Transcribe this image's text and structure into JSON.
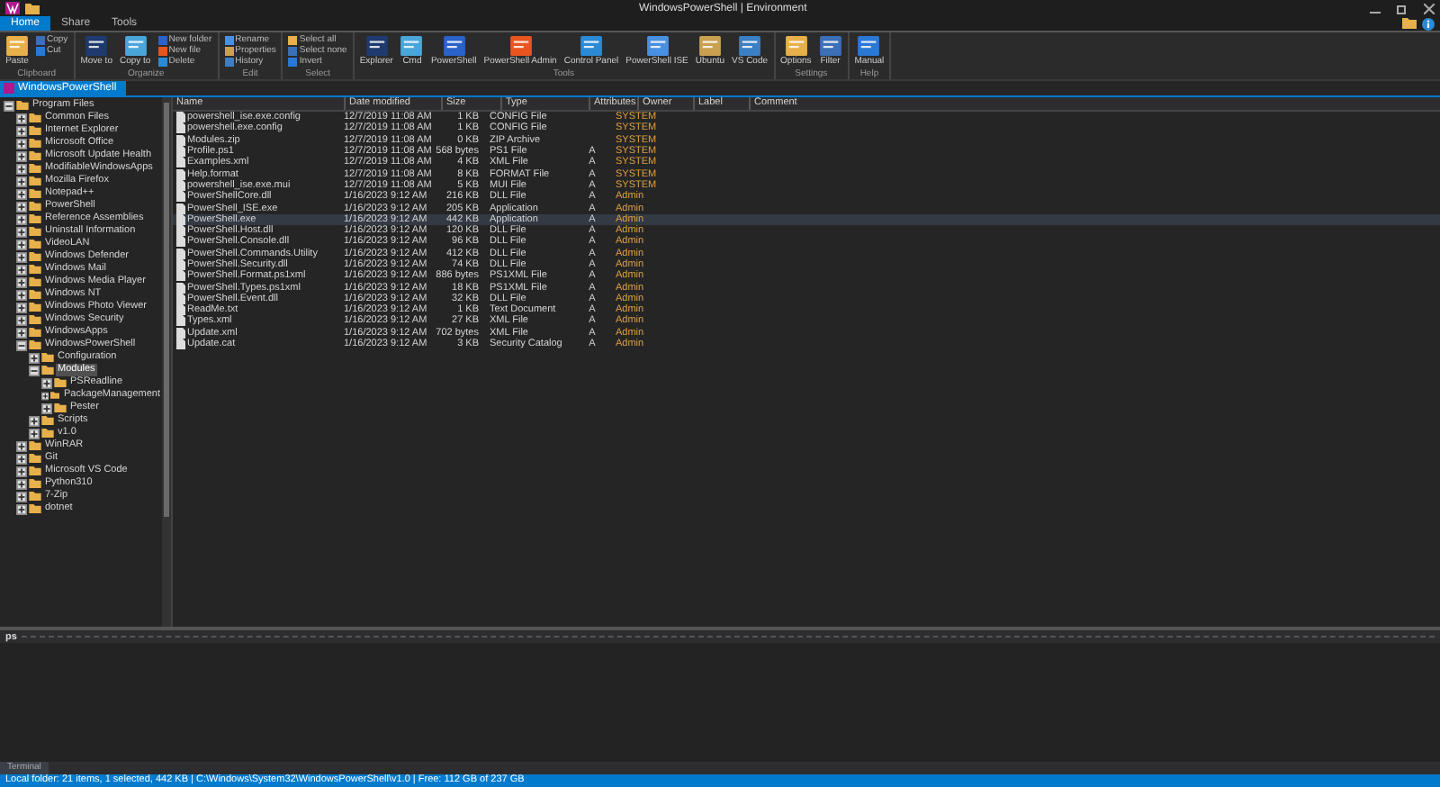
{
  "window": {
    "title": "WindowsPowerShell | Environment"
  },
  "ribbon_tabs": [
    {
      "label": "Home",
      "selected": true
    },
    {
      "label": "Share",
      "selected": false
    },
    {
      "label": "Tools",
      "selected": false
    }
  ],
  "ribbon_groups": [
    {
      "label": "Clipboard",
      "items": [
        {
          "label": "Paste",
          "kind": "large"
        },
        {
          "label": "Copy",
          "kind": "small"
        },
        {
          "label": "Cut",
          "kind": "small"
        }
      ]
    },
    {
      "label": "Organize",
      "items": [
        {
          "label": "Move to",
          "kind": "large"
        },
        {
          "label": "Copy to",
          "kind": "large"
        },
        {
          "label": "New folder",
          "kind": "small"
        },
        {
          "label": "New file",
          "kind": "small"
        },
        {
          "label": "Delete",
          "kind": "small"
        }
      ]
    },
    {
      "label": "Edit",
      "items": [
        {
          "label": "Rename",
          "kind": "small"
        },
        {
          "label": "Properties",
          "kind": "small"
        },
        {
          "label": "History",
          "kind": "small"
        }
      ]
    },
    {
      "label": "Select",
      "items": [
        {
          "label": "Select all",
          "kind": "small"
        },
        {
          "label": "Select none",
          "kind": "small"
        },
        {
          "label": "Invert",
          "kind": "small"
        }
      ]
    },
    {
      "label": "Tools",
      "items": [
        {
          "label": "Explorer",
          "kind": "large"
        },
        {
          "label": "Cmd",
          "kind": "large"
        },
        {
          "label": "PowerShell",
          "kind": "large"
        },
        {
          "label": "PowerShell Admin",
          "kind": "large"
        },
        {
          "label": "Control Panel",
          "kind": "large"
        },
        {
          "label": "PowerShell ISE",
          "kind": "large"
        },
        {
          "label": "Ubuntu",
          "kind": "large"
        },
        {
          "label": "VS Code",
          "kind": "large"
        }
      ]
    },
    {
      "label": "Settings",
      "items": [
        {
          "label": "Options",
          "kind": "large"
        },
        {
          "label": "Filter",
          "kind": "large"
        }
      ]
    },
    {
      "label": "Help",
      "items": [
        {
          "label": "Manual",
          "kind": "large"
        }
      ]
    }
  ],
  "folder_tab": {
    "label": "WindowsPowerShell"
  },
  "tree": [
    {
      "label": "Program Files",
      "expanded": true,
      "selected": false,
      "children": [
        {
          "label": "Common Files",
          "expanded": false,
          "selected": false
        },
        {
          "label": "Internet Explorer",
          "expanded": false,
          "selected": false
        },
        {
          "label": "Microsoft Office",
          "expanded": false,
          "selected": false
        },
        {
          "label": "Microsoft Update Health",
          "expanded": false,
          "selected": false
        },
        {
          "label": "ModifiableWindowsApps",
          "expanded": false,
          "selected": false
        },
        {
          "label": "Mozilla Firefox",
          "expanded": false,
          "selected": false
        },
        {
          "label": "Notepad++",
          "expanded": false,
          "selected": false
        },
        {
          "label": "PowerShell",
          "expanded": false,
          "selected": false
        },
        {
          "label": "Reference Assemblies",
          "expanded": false,
          "selected": false
        },
        {
          "label": "Uninstall Information",
          "expanded": false,
          "selected": false
        },
        {
          "label": "VideoLAN",
          "expanded": false,
          "selected": false
        },
        {
          "label": "Windows Defender",
          "expanded": false,
          "selected": false
        },
        {
          "label": "Windows Mail",
          "expanded": false,
          "selected": false
        },
        {
          "label": "Windows Media Player",
          "expanded": false,
          "selected": false
        },
        {
          "label": "Windows NT",
          "expanded": false,
          "selected": false
        },
        {
          "label": "Windows Photo Viewer",
          "expanded": false,
          "selected": false
        },
        {
          "label": "Windows Security",
          "expanded": false,
          "selected": false
        },
        {
          "label": "WindowsApps",
          "expanded": false,
          "selected": false
        },
        {
          "label": "WindowsPowerShell",
          "expanded": true,
          "selected": false,
          "children": [
            {
              "label": "Configuration",
              "expanded": false,
              "selected": false
            },
            {
              "label": "Modules",
              "expanded": true,
              "selected": true,
              "children": [
                {
                  "label": "PSReadline",
                  "expanded": false,
                  "selected": false
                },
                {
                  "label": "PackageManagement",
                  "expanded": false,
                  "selected": false
                },
                {
                  "label": "Pester",
                  "expanded": false,
                  "selected": false
                }
              ]
            },
            {
              "label": "Scripts",
              "expanded": false,
              "selected": false
            },
            {
              "label": "v1.0",
              "expanded": false,
              "selected": false
            }
          ]
        },
        {
          "label": "WinRAR",
          "expanded": false,
          "selected": false
        },
        {
          "label": "Git",
          "expanded": false,
          "selected": false
        },
        {
          "label": "Microsoft VS Code",
          "expanded": false,
          "selected": false
        },
        {
          "label": "Python310",
          "expanded": false,
          "selected": false
        },
        {
          "label": "7-Zip",
          "expanded": false,
          "selected": false
        },
        {
          "label": "dotnet",
          "expanded": false,
          "selected": false
        }
      ]
    }
  ],
  "file_columns": [
    "Name",
    "Date modified",
    "Size",
    "Type",
    "Attributes",
    "Owner",
    "Label",
    "Comment"
  ],
  "files": [
    {
      "name": "powershell_ise.exe.config",
      "date": "12/7/2019 11:08 AM",
      "size": "1 KB",
      "type": "CONFIG File",
      "owner": "SYSTEM",
      "selected": false
    },
    {
      "name": "powershell.exe.config",
      "date": "12/7/2019 11:08 AM",
      "size": "1 KB",
      "type": "CONFIG File",
      "owner": "SYSTEM",
      "selected": false
    },
    {
      "name": "Modules.zip",
      "date": "12/7/2019 11:08 AM",
      "size": "0 KB",
      "type": "ZIP Archive",
      "owner": "SYSTEM",
      "selected": false
    },
    {
      "name": "Profile.ps1",
      "date": "12/7/2019 11:08 AM",
      "size": "568 bytes",
      "type": "PS1 File",
      "attributes": "A",
      "owner": "SYSTEM",
      "selected": false
    },
    {
      "name": "Examples.xml",
      "date": "12/7/2019 11:08 AM",
      "size": "4 KB",
      "type": "XML File",
      "attributes": "A",
      "owner": "SYSTEM",
      "selected": false
    },
    {
      "name": "Help.format",
      "date": "12/7/2019 11:08 AM",
      "size": "8 KB",
      "type": "FORMAT File",
      "attributes": "A",
      "owner": "SYSTEM",
      "selected": false
    },
    {
      "name": "powershell_ise.exe.mui",
      "date": "12/7/2019 11:08 AM",
      "size": "5 KB",
      "type": "MUI File",
      "attributes": "A",
      "owner": "SYSTEM",
      "selected": false
    },
    {
      "name": "PowerShellCore.dll",
      "date": "1/16/2023 9:12 AM",
      "size": "216 KB",
      "type": "DLL File",
      "attributes": "A",
      "owner": "Admin",
      "selected": false
    },
    {
      "name": "PowerShell_ISE.exe",
      "date": "1/16/2023 9:12 AM",
      "size": "205 KB",
      "type": "Application",
      "attributes": "A",
      "owner": "Admin",
      "selected": false
    },
    {
      "name": "PowerShell.exe",
      "date": "1/16/2023 9:12 AM",
      "size": "442 KB",
      "type": "Application",
      "attributes": "A",
      "owner": "Admin",
      "selected": true
    },
    {
      "name": "PowerShell.Host.dll",
      "date": "1/16/2023 9:12 AM",
      "size": "120 KB",
      "type": "DLL File",
      "attributes": "A",
      "owner": "Admin",
      "selected": false
    },
    {
      "name": "PowerShell.Console.dll",
      "date": "1/16/2023 9:12 AM",
      "size": "96 KB",
      "type": "DLL File",
      "attributes": "A",
      "owner": "Admin",
      "selected": false
    },
    {
      "name": "PowerShell.Commands.Utility",
      "date": "1/16/2023 9:12 AM",
      "size": "412 KB",
      "type": "DLL File",
      "attributes": "A",
      "owner": "Admin",
      "selected": false
    },
    {
      "name": "PowerShell.Security.dll",
      "date": "1/16/2023 9:12 AM",
      "size": "74 KB",
      "type": "DLL File",
      "attributes": "A",
      "owner": "Admin",
      "selected": false
    },
    {
      "name": "PowerShell.Format.ps1xml",
      "date": "1/16/2023 9:12 AM",
      "size": "886 bytes",
      "type": "PS1XML File",
      "attributes": "A",
      "owner": "Admin",
      "selected": false
    },
    {
      "name": "PowerShell.Types.ps1xml",
      "date": "1/16/2023 9:12 AM",
      "size": "18 KB",
      "type": "PS1XML File",
      "attributes": "A",
      "owner": "Admin",
      "selected": false
    },
    {
      "name": "PowerShell.Event.dll",
      "date": "1/16/2023 9:12 AM",
      "size": "32 KB",
      "type": "DLL File",
      "attributes": "A",
      "owner": "Admin",
      "selected": false
    },
    {
      "name": "ReadMe.txt",
      "date": "1/16/2023 9:12 AM",
      "size": "1 KB",
      "type": "Text Document",
      "attributes": "A",
      "owner": "Admin",
      "selected": false
    },
    {
      "name": "Types.xml",
      "date": "1/16/2023 9:12 AM",
      "size": "27 KB",
      "type": "XML File",
      "attributes": "A",
      "owner": "Admin",
      "selected": false
    },
    {
      "name": "Update.xml",
      "date": "1/16/2023 9:12 AM",
      "size": "702 bytes",
      "type": "XML File",
      "attributes": "A",
      "owner": "Admin",
      "selected": false
    },
    {
      "name": "Update.cat",
      "date": "1/16/2023 9:12 AM",
      "size": "3 KB",
      "type": "Security Catalog",
      "attributes": "A",
      "owner": "Admin",
      "selected": false
    }
  ],
  "console": {
    "title": "ps",
    "tab": "Terminal"
  },
  "status_bar": "Local folder: 21 items, 1 selected, 442 KB  |  C:\\Windows\\System32\\WindowsPowerShell\\v1.0  |  Free: 112 GB of 237 GB"
}
